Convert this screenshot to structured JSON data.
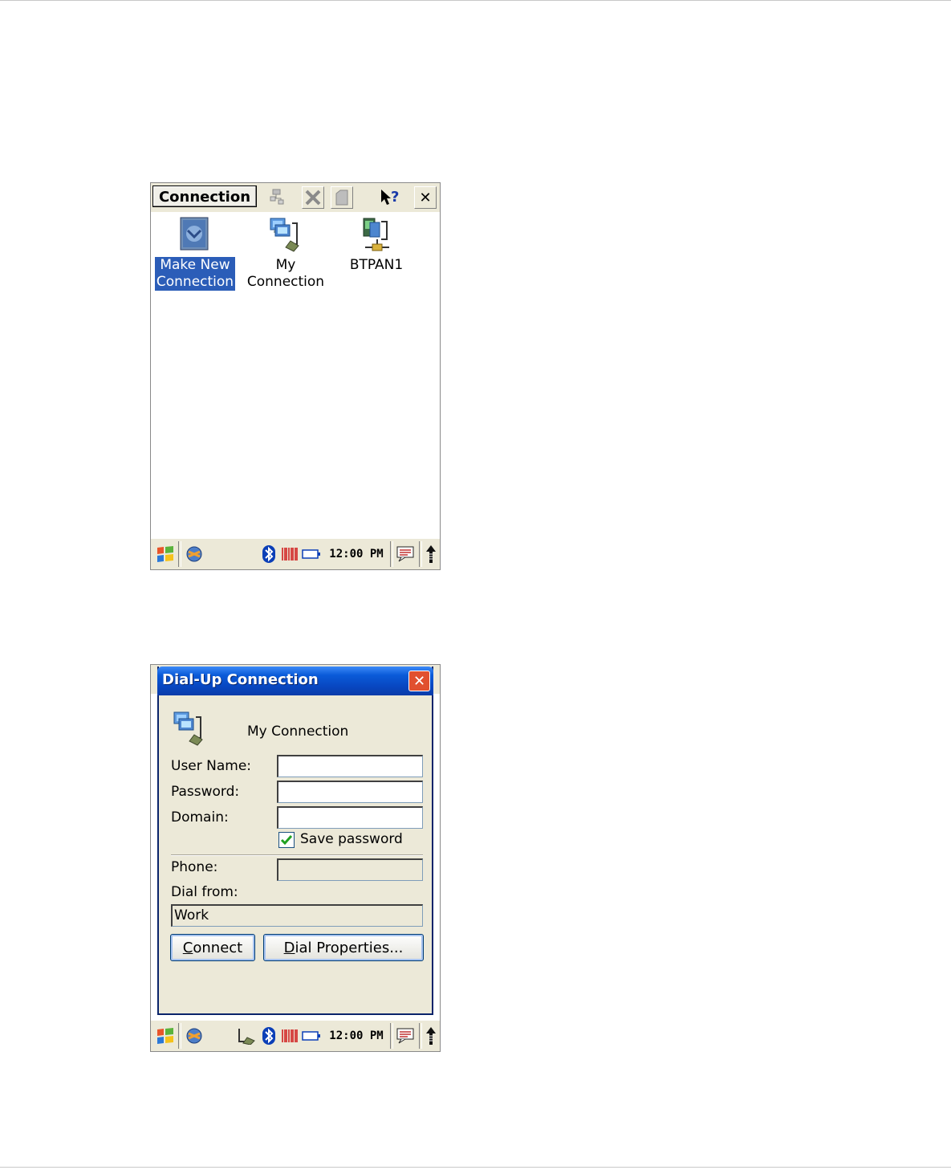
{
  "screen1": {
    "commandbar": {
      "title": "Connection",
      "icons": [
        "properties-icon",
        "delete-icon",
        "blank-icon",
        "help-icon",
        "close-icon"
      ],
      "close_glyph": "✕"
    },
    "items": [
      {
        "line1": "Make New",
        "line2": "Connection",
        "icon": "make-new-connection-icon",
        "selected": true
      },
      {
        "line1": "My",
        "line2": "Connection",
        "icon": "dialup-connection-icon",
        "selected": false
      },
      {
        "line1": "BTPAN1",
        "line2": "",
        "icon": "btpan-connection-icon",
        "selected": false
      }
    ],
    "taskbar": {
      "time": "12:00 PM"
    }
  },
  "screen2": {
    "dialog": {
      "title": "Dial-Up Connection",
      "close_glyph": "✕",
      "connection_name": "My Connection",
      "user_name_label": "User Name:",
      "user_name_value": "",
      "password_label": "Password:",
      "password_value": "",
      "domain_label": "Domain:",
      "domain_value": "",
      "save_password_label": "Save password",
      "save_password_checked": true,
      "phone_label": "Phone:",
      "phone_value": "",
      "dial_from_label": "Dial from:",
      "dial_from_value": "Work",
      "connect_button": {
        "accel": "C",
        "rest": "onnect"
      },
      "dial_properties_button": {
        "accel": "D",
        "rest": "ial Properties..."
      }
    },
    "taskbar": {
      "time": "12:00 PM"
    }
  },
  "colors": {
    "selection": "#2b5db8",
    "titlebar": "#0a5bd8",
    "dialog_bg": "#ece9d8",
    "close_red": "#e1502f"
  }
}
